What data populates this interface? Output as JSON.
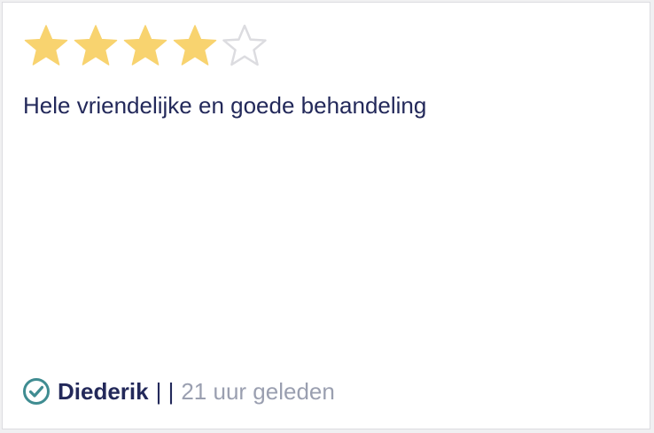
{
  "review": {
    "rating": 4,
    "max_rating": 5,
    "text": "Hele vriendelijke en goede behandeling",
    "author": "Diederik",
    "separator": "| |",
    "time_ago": "21 uur geleden"
  },
  "colors": {
    "star_filled": "#f8d36f",
    "star_empty_stroke": "#dcdce0",
    "text": "#23295a",
    "muted": "#9a9fb0",
    "verified": "#3f8c91"
  },
  "icons": {
    "star": "star-icon",
    "verified": "verified-check-icon"
  }
}
